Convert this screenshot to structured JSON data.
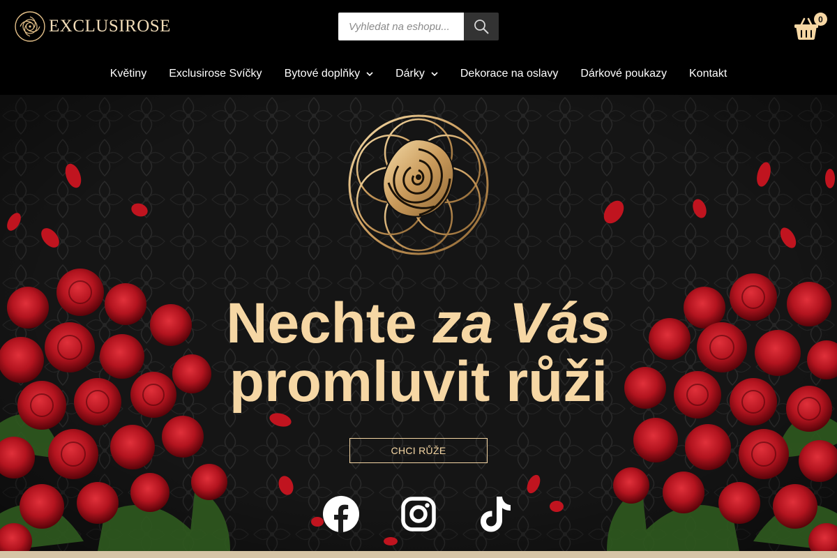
{
  "brand": {
    "name": "EXCLUSIROSE",
    "accent": "#f6d7a4",
    "gold": "#c9a36a"
  },
  "search": {
    "placeholder": "Vyhledat na eshopu...",
    "value": ""
  },
  "cart": {
    "count": "0"
  },
  "nav": {
    "items": [
      {
        "label": "Květiny",
        "has_dropdown": false
      },
      {
        "label": "Exclusirose Svíčky",
        "has_dropdown": false
      },
      {
        "label": "Bytové doplňky",
        "has_dropdown": true
      },
      {
        "label": "Dárky",
        "has_dropdown": true
      },
      {
        "label": "Dekorace na oslavy",
        "has_dropdown": false
      },
      {
        "label": "Dárkové poukazy",
        "has_dropdown": false
      },
      {
        "label": "Kontakt",
        "has_dropdown": false
      }
    ]
  },
  "hero": {
    "headline_part1": "Nechte ",
    "headline_italic": "za Vás",
    "headline_line2": "promluvit růži",
    "cta_label": "CHCI RŮŽE"
  },
  "social": [
    {
      "icon": "facebook-icon"
    },
    {
      "icon": "instagram-icon"
    },
    {
      "icon": "tiktok-icon"
    }
  ]
}
